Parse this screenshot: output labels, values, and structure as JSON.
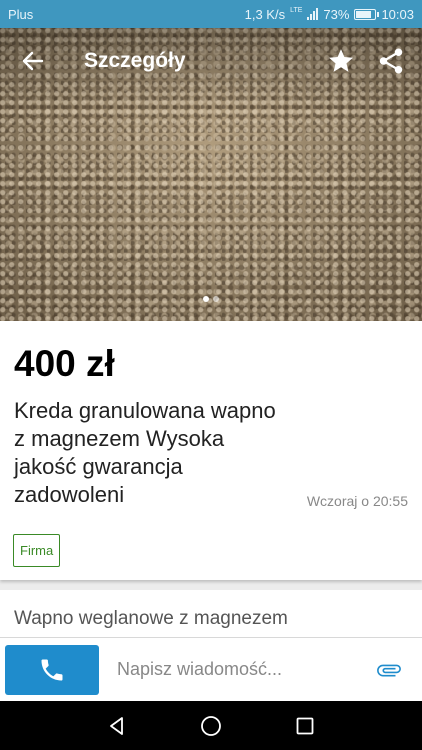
{
  "status_bar": {
    "carrier": "Plus",
    "speed": "1,3 K/s",
    "network": "LTE",
    "battery": "73%",
    "time": "10:03"
  },
  "toolbar": {
    "title": "Szczegóły",
    "icons": [
      "arrow-left-icon",
      "star-icon",
      "share-icon"
    ]
  },
  "gallery": {
    "image": "granulated lime pellets",
    "page_count": 2,
    "current_page": 1
  },
  "ad": {
    "price": "400 zł",
    "title": "Kreda granulowana wapno z magnezem Wysoka jakość gwarancja zadowoleni",
    "date": "Wczoraj o 20:55",
    "seller_badge": "Firma"
  },
  "description": {
    "heading": "Wapno weglanowe z magnezem"
  },
  "bottom_bar": {
    "call_icon": "phone-icon",
    "message_placeholder": "Napisz wiadomość...",
    "attach_icon": "paperclip-icon"
  },
  "colors": {
    "status_bar": "#3f97bf",
    "call_button": "#1f8ccc",
    "badge": "#3a8a26"
  }
}
